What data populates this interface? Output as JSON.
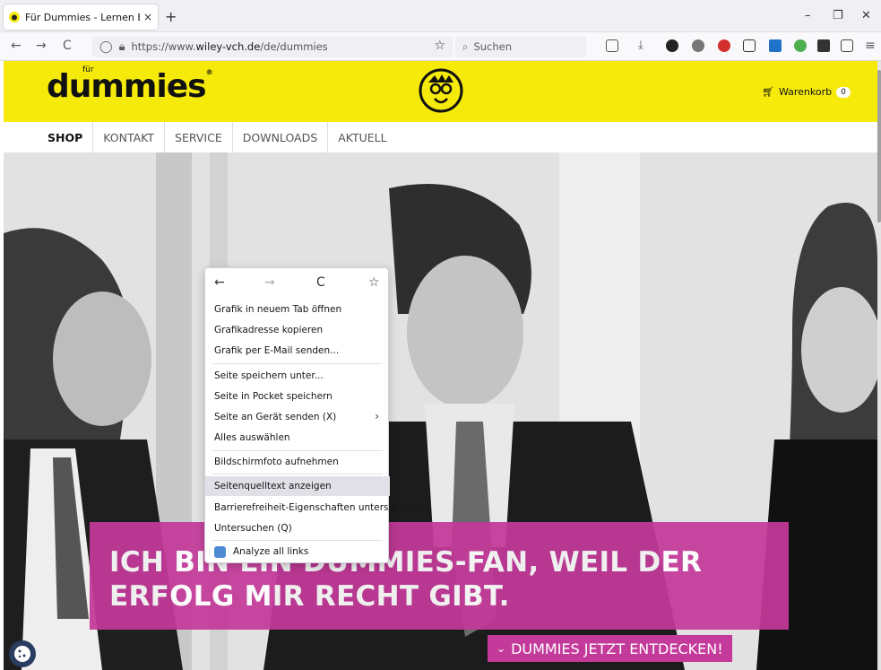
{
  "browser": {
    "tab_title": "Für Dummies - Lernen Einfach (",
    "tab_close": "×",
    "new_tab": "+",
    "win_min": "–",
    "win_restore": "❐",
    "win_close": "✕",
    "back": "←",
    "forward": "→",
    "reload": "C",
    "url_prefix": "https://www.",
    "url_host": "wiley-vch.de",
    "url_path": "/de/dummies",
    "bookmark_star": "☆",
    "search_icon": "⌕",
    "search_placeholder": "Suchen",
    "menu": "≡"
  },
  "site": {
    "logo_small": "für",
    "logo": "dummies",
    "logo_reg": "®",
    "cart_label": "Warenkorb",
    "cart_count": "0",
    "nav": [
      "SHOP",
      "KONTAKT",
      "SERVICE",
      "DOWNLOADS",
      "AKTUELL"
    ],
    "banner_line1": "ICH BIN EIN DUMMIES-FAN, WEIL DER",
    "banner_line2": "ERFOLG MIR RECHT GIBT.",
    "cta_icon": "⌄",
    "cta": "DUMMIES JETZT ENTDECKEN!"
  },
  "context_menu": {
    "back": "←",
    "forward": "→",
    "reload": "C",
    "bookmark": "☆",
    "items": [
      "Grafik in neuem Tab öffnen",
      "Grafikadresse kopieren",
      "Grafik per E-Mail senden...",
      "Seite speichern unter...",
      "Seite in Pocket speichern",
      "Seite an Gerät senden (X)",
      "Alles auswählen",
      "Bildschirmfoto aufnehmen",
      "Seitenquelltext anzeigen",
      "Barrierefreiheit-Eigenschaften untersuchen",
      "Untersuchen (Q)",
      "Analyze all links"
    ],
    "submenu_chevron": "›"
  },
  "colors": {
    "header_yellow": "#f6ea0b",
    "banner_magenta": "#c43a9a"
  }
}
